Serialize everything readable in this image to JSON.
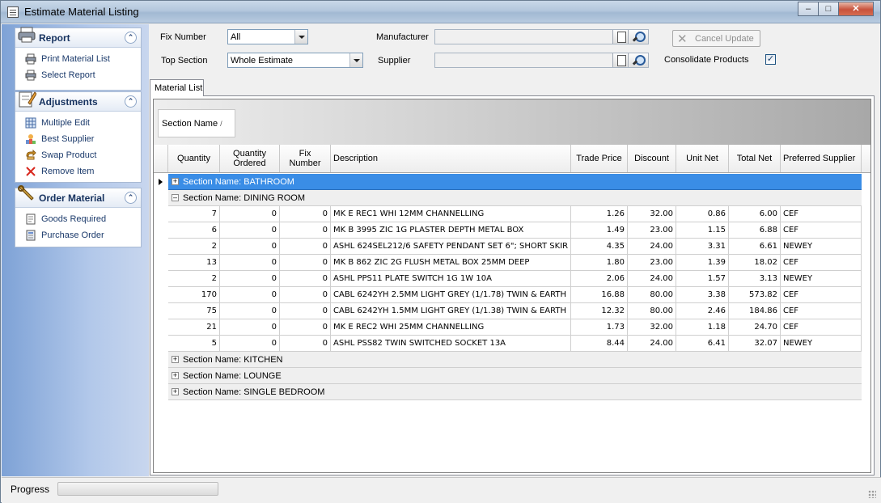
{
  "window": {
    "title": "Estimate Material Listing",
    "minimize": "–",
    "maximize": "□",
    "close": "✕"
  },
  "sidebar": {
    "report": {
      "title": "Report",
      "collapse": "⌃",
      "items": [
        "Print Material List",
        "Select Report"
      ]
    },
    "adjustments": {
      "title": "Adjustments",
      "collapse": "⌃",
      "items": [
        "Multiple Edit",
        "Best Supplier",
        "Swap Product",
        "Remove Item"
      ]
    },
    "order": {
      "title": "Order Material",
      "collapse": "⌃",
      "items": [
        "Goods Required",
        "Purchase Order"
      ]
    }
  },
  "filters": {
    "fix_number_label": "Fix Number",
    "fix_number_value": "All",
    "top_section_label": "Top Section",
    "top_section_value": "Whole Estimate",
    "manufacturer_label": "Manufacturer",
    "supplier_label": "Supplier",
    "cancel_update": "Cancel Update",
    "consolidate_label": "Consolidate Products",
    "consolidate_checked": "✓"
  },
  "tabs": {
    "material_list": "Material List"
  },
  "grid": {
    "group_by_label": "Section Name",
    "group_sort_indicator": "/",
    "columns": [
      "Quantity",
      "Quantity Ordered",
      "Fix Number",
      "Description",
      "Trade Price",
      "Discount",
      "Unit Net",
      "Total Net",
      "Preferred Supplier"
    ],
    "groups": [
      {
        "label": "Section Name: BATHROOM",
        "expanded": false,
        "selected": true,
        "toggle": "+"
      },
      {
        "label": "Section Name: DINING ROOM",
        "expanded": true,
        "selected": false,
        "toggle": "–"
      },
      {
        "label": "Section Name: KITCHEN",
        "expanded": false,
        "selected": false,
        "toggle": "+"
      },
      {
        "label": "Section Name: LOUNGE",
        "expanded": false,
        "selected": false,
        "toggle": "+"
      },
      {
        "label": "Section Name: SINGLE BEDROOM",
        "expanded": false,
        "selected": false,
        "toggle": "+"
      }
    ],
    "rows": [
      [
        "7",
        "0",
        "0",
        "MK E REC1 WHI 12MM CHANNELLING",
        "1.26",
        "32.00",
        "0.86",
        "6.00",
        "CEF"
      ],
      [
        "6",
        "0",
        "0",
        "MK B 3995 ZIC 1G PLASTER DEPTH METAL BOX",
        "1.49",
        "23.00",
        "1.15",
        "6.88",
        "CEF"
      ],
      [
        "2",
        "0",
        "0",
        "ASHL 624SEL212/6 SAFETY PENDANT SET 6\"; SHORT SKIR",
        "4.35",
        "24.00",
        "3.31",
        "6.61",
        "NEWEY"
      ],
      [
        "13",
        "0",
        "0",
        "MK B 862 ZIC 2G FLUSH METAL BOX 25MM DEEP",
        "1.80",
        "23.00",
        "1.39",
        "18.02",
        "CEF"
      ],
      [
        "2",
        "0",
        "0",
        "ASHL PPS11 PLATE SWITCH 1G 1W 10A",
        "2.06",
        "24.00",
        "1.57",
        "3.13",
        "NEWEY"
      ],
      [
        "170",
        "0",
        "0",
        "CABL 6242YH 2.5MM LIGHT GREY (1/1.78) TWIN & EARTH",
        "16.88",
        "80.00",
        "3.38",
        "573.82",
        "CEF"
      ],
      [
        "75",
        "0",
        "0",
        "CABL 6242YH 1.5MM LIGHT GREY (1/1.38) TWIN & EARTH",
        "12.32",
        "80.00",
        "2.46",
        "184.86",
        "CEF"
      ],
      [
        "21",
        "0",
        "0",
        "MK E REC2 WHI 25MM CHANNELLING",
        "1.73",
        "32.00",
        "1.18",
        "24.70",
        "CEF"
      ],
      [
        "5",
        "0",
        "0",
        "ASHL PSS82 TWIN SWITCHED SOCKET 13A",
        "8.44",
        "24.00",
        "6.41",
        "32.07",
        "NEWEY"
      ]
    ]
  },
  "status": {
    "progress_label": "Progress",
    "progress": 0
  }
}
